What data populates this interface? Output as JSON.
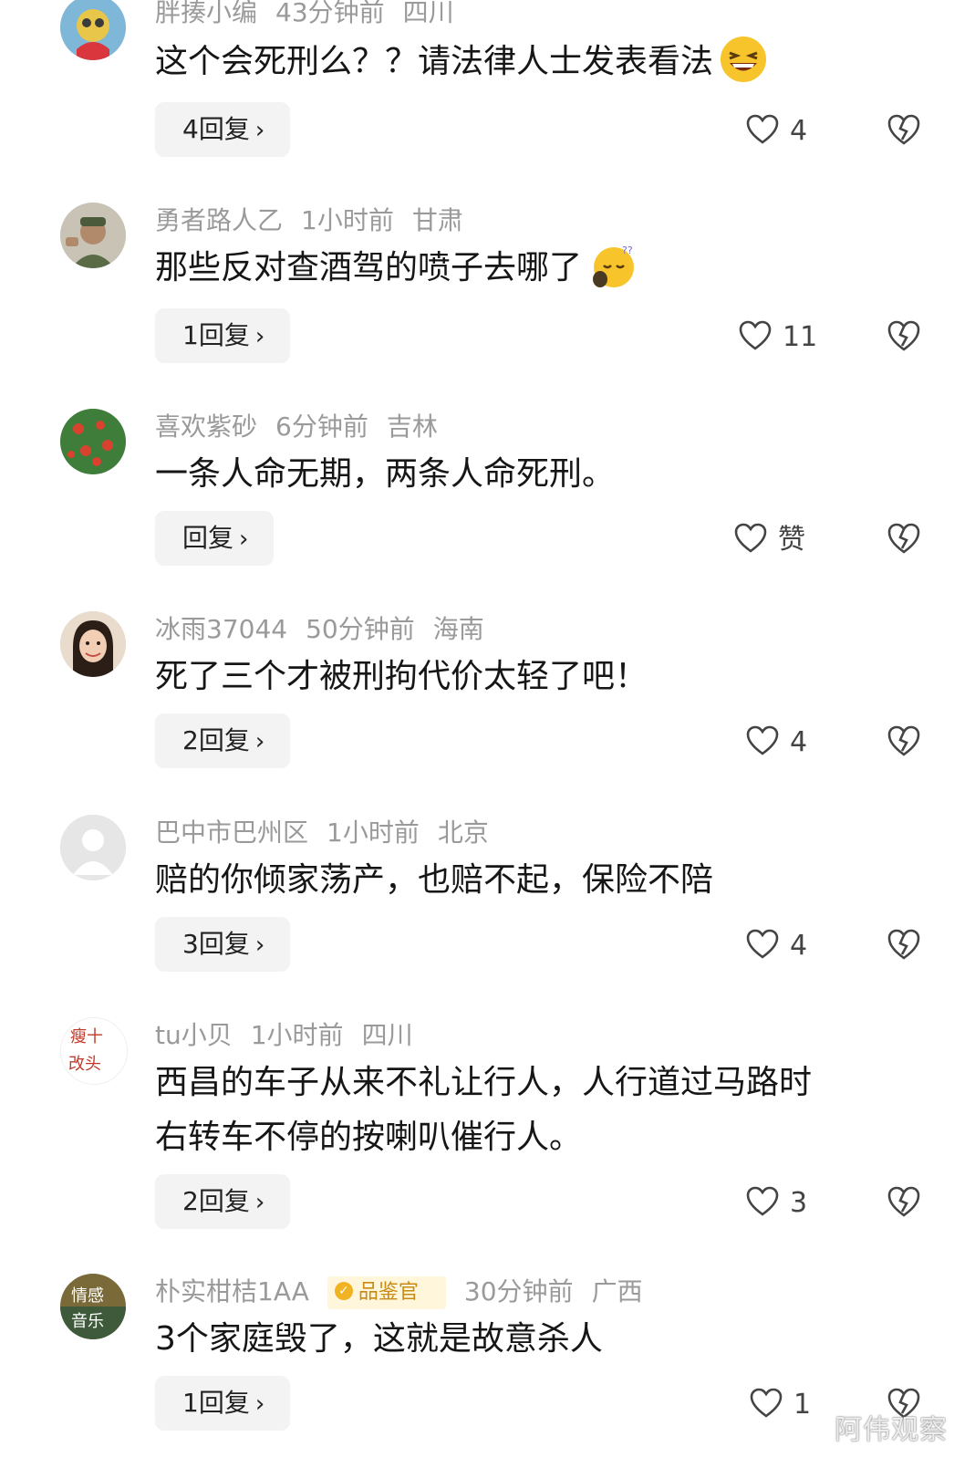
{
  "comments": [
    {
      "username": "胖揍小编",
      "time": "43分钟前",
      "location": "四川",
      "text": "这个会死刑么？？请法律人士发表看法",
      "emoji": "laughing-emoji",
      "reply_label": "4回复",
      "likes": "4"
    },
    {
      "username": "勇者路人乙",
      "time": "1小时前",
      "location": "甘肃",
      "text": "那些反对查酒驾的喷子去哪了",
      "emoji": "sleepy-emoji",
      "reply_label": "1回复",
      "likes": "11"
    },
    {
      "username": "喜欢紫砂",
      "time": "6分钟前",
      "location": "吉林",
      "text": "一条人命无期，两条人命死刑。",
      "reply_label": "回复",
      "likes": "赞"
    },
    {
      "username": "冰雨37044",
      "time": "50分钟前",
      "location": "海南",
      "text": "死了三个才被刑拘代价太轻了吧！",
      "reply_label": "2回复",
      "likes": "4"
    },
    {
      "username": "巴中市巴州区",
      "time": "1小时前",
      "location": "北京",
      "text": "赔的你倾家荡产，也赔不起，保险不陪",
      "reply_label": "3回复",
      "likes": "4"
    },
    {
      "username": "tu小贝",
      "time": "1小时前",
      "location": "四川",
      "text_lines": [
        "西昌的车子从来不礼让行人，人行道过马路时",
        "右转车不停的按喇叭催行人。"
      ],
      "avatar_text": [
        "瘦十",
        "改头"
      ],
      "reply_label": "2回复",
      "likes": "3"
    },
    {
      "username": "朴实柑桔1AA",
      "badge": "品鉴官",
      "time": "30分钟前",
      "location": "广西",
      "text": "3个家庭毁了，这就是故意杀人",
      "avatar_text": [
        "情感",
        "音乐"
      ],
      "reply_label": "1回复",
      "likes": "1"
    }
  ],
  "reply_chevron": "›",
  "watermark": "阿伟观察",
  "colors": {
    "meta": "#9a9a9a",
    "text": "#161616",
    "reply_bg": "#f3f3f3",
    "badge_bg": "#fff6dc",
    "badge_fg": "#c88a12"
  }
}
